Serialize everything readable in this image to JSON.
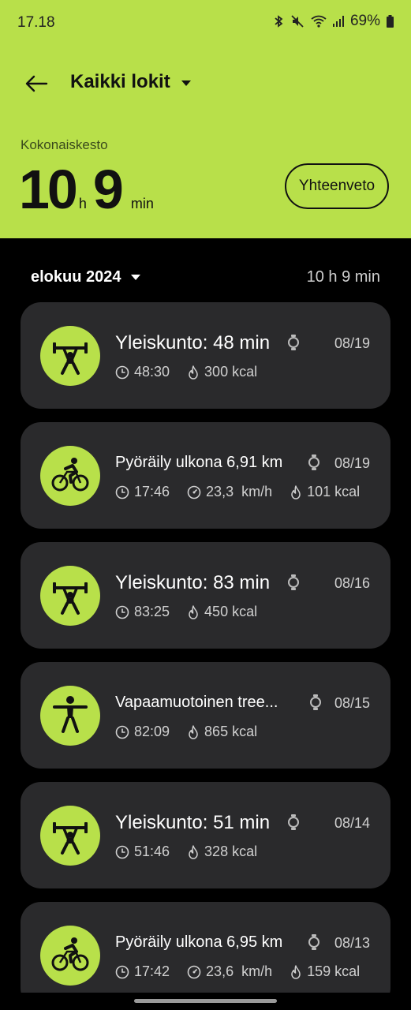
{
  "status_bar": {
    "time": "17.18",
    "battery": "69%"
  },
  "header": {
    "title": "Kaikki lokit",
    "duration_label": "Kokonaiskesto",
    "hours": "10",
    "hours_unit": "h",
    "minutes": "9",
    "minutes_unit": "min",
    "summary_label": "Yhteenveto",
    "accent_color": "#b8e04a"
  },
  "month": {
    "label": "elokuu 2024",
    "total": "10 h 9 min"
  },
  "workouts": [
    {
      "type": "weights",
      "icon": "weightlifting-icon",
      "title": "Yleiskunto: 48 min",
      "date": "08/19",
      "duration": "48:30",
      "kcal": "300 kcal"
    },
    {
      "type": "cycling",
      "icon": "cycling-icon",
      "title": "Pyöräily ulkona 6,91 km",
      "date": "08/19",
      "duration": "17:46",
      "speed": "23,3  km/h",
      "kcal": "101 kcal"
    },
    {
      "type": "weights",
      "icon": "weightlifting-icon",
      "title": "Yleiskunto: 83 min",
      "date": "08/16",
      "duration": "83:25",
      "kcal": "450 kcal"
    },
    {
      "type": "freeform",
      "icon": "person-icon",
      "title": "Vapaamuotoinen tree...",
      "date": "08/15",
      "duration": "82:09",
      "kcal": "865 kcal"
    },
    {
      "type": "weights",
      "icon": "weightlifting-icon",
      "title": "Yleiskunto: 51 min",
      "date": "08/14",
      "duration": "51:46",
      "kcal": "328 kcal"
    },
    {
      "type": "cycling",
      "icon": "cycling-icon",
      "title": "Pyöräily ulkona 6,95 km",
      "date": "08/13",
      "duration": "17:42",
      "speed": "23,6  km/h",
      "kcal": "159 kcal"
    }
  ]
}
